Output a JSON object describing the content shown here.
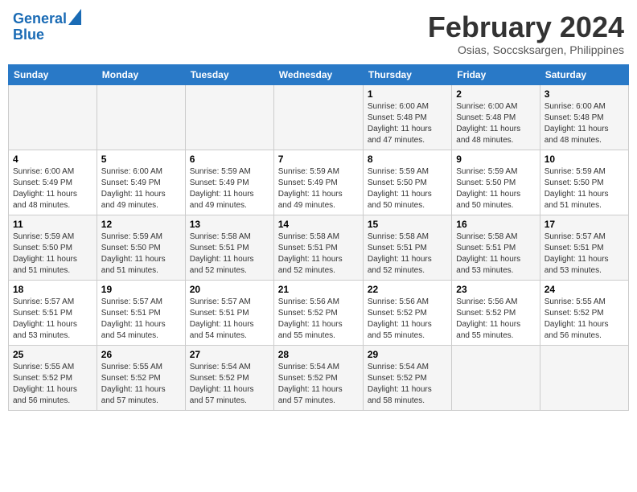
{
  "header": {
    "logo_line1": "General",
    "logo_line2": "Blue",
    "title": "February 2024",
    "subtitle": "Osias, Soccsksargen, Philippines"
  },
  "weekdays": [
    "Sunday",
    "Monday",
    "Tuesday",
    "Wednesday",
    "Thursday",
    "Friday",
    "Saturday"
  ],
  "weeks": [
    [
      {
        "day": "",
        "info": ""
      },
      {
        "day": "",
        "info": ""
      },
      {
        "day": "",
        "info": ""
      },
      {
        "day": "",
        "info": ""
      },
      {
        "day": "1",
        "info": "Sunrise: 6:00 AM\nSunset: 5:48 PM\nDaylight: 11 hours\nand 47 minutes."
      },
      {
        "day": "2",
        "info": "Sunrise: 6:00 AM\nSunset: 5:48 PM\nDaylight: 11 hours\nand 48 minutes."
      },
      {
        "day": "3",
        "info": "Sunrise: 6:00 AM\nSunset: 5:48 PM\nDaylight: 11 hours\nand 48 minutes."
      }
    ],
    [
      {
        "day": "4",
        "info": "Sunrise: 6:00 AM\nSunset: 5:49 PM\nDaylight: 11 hours\nand 48 minutes."
      },
      {
        "day": "5",
        "info": "Sunrise: 6:00 AM\nSunset: 5:49 PM\nDaylight: 11 hours\nand 49 minutes."
      },
      {
        "day": "6",
        "info": "Sunrise: 5:59 AM\nSunset: 5:49 PM\nDaylight: 11 hours\nand 49 minutes."
      },
      {
        "day": "7",
        "info": "Sunrise: 5:59 AM\nSunset: 5:49 PM\nDaylight: 11 hours\nand 49 minutes."
      },
      {
        "day": "8",
        "info": "Sunrise: 5:59 AM\nSunset: 5:50 PM\nDaylight: 11 hours\nand 50 minutes."
      },
      {
        "day": "9",
        "info": "Sunrise: 5:59 AM\nSunset: 5:50 PM\nDaylight: 11 hours\nand 50 minutes."
      },
      {
        "day": "10",
        "info": "Sunrise: 5:59 AM\nSunset: 5:50 PM\nDaylight: 11 hours\nand 51 minutes."
      }
    ],
    [
      {
        "day": "11",
        "info": "Sunrise: 5:59 AM\nSunset: 5:50 PM\nDaylight: 11 hours\nand 51 minutes."
      },
      {
        "day": "12",
        "info": "Sunrise: 5:59 AM\nSunset: 5:50 PM\nDaylight: 11 hours\nand 51 minutes."
      },
      {
        "day": "13",
        "info": "Sunrise: 5:58 AM\nSunset: 5:51 PM\nDaylight: 11 hours\nand 52 minutes."
      },
      {
        "day": "14",
        "info": "Sunrise: 5:58 AM\nSunset: 5:51 PM\nDaylight: 11 hours\nand 52 minutes."
      },
      {
        "day": "15",
        "info": "Sunrise: 5:58 AM\nSunset: 5:51 PM\nDaylight: 11 hours\nand 52 minutes."
      },
      {
        "day": "16",
        "info": "Sunrise: 5:58 AM\nSunset: 5:51 PM\nDaylight: 11 hours\nand 53 minutes."
      },
      {
        "day": "17",
        "info": "Sunrise: 5:57 AM\nSunset: 5:51 PM\nDaylight: 11 hours\nand 53 minutes."
      }
    ],
    [
      {
        "day": "18",
        "info": "Sunrise: 5:57 AM\nSunset: 5:51 PM\nDaylight: 11 hours\nand 53 minutes."
      },
      {
        "day": "19",
        "info": "Sunrise: 5:57 AM\nSunset: 5:51 PM\nDaylight: 11 hours\nand 54 minutes."
      },
      {
        "day": "20",
        "info": "Sunrise: 5:57 AM\nSunset: 5:51 PM\nDaylight: 11 hours\nand 54 minutes."
      },
      {
        "day": "21",
        "info": "Sunrise: 5:56 AM\nSunset: 5:52 PM\nDaylight: 11 hours\nand 55 minutes."
      },
      {
        "day": "22",
        "info": "Sunrise: 5:56 AM\nSunset: 5:52 PM\nDaylight: 11 hours\nand 55 minutes."
      },
      {
        "day": "23",
        "info": "Sunrise: 5:56 AM\nSunset: 5:52 PM\nDaylight: 11 hours\nand 55 minutes."
      },
      {
        "day": "24",
        "info": "Sunrise: 5:55 AM\nSunset: 5:52 PM\nDaylight: 11 hours\nand 56 minutes."
      }
    ],
    [
      {
        "day": "25",
        "info": "Sunrise: 5:55 AM\nSunset: 5:52 PM\nDaylight: 11 hours\nand 56 minutes."
      },
      {
        "day": "26",
        "info": "Sunrise: 5:55 AM\nSunset: 5:52 PM\nDaylight: 11 hours\nand 57 minutes."
      },
      {
        "day": "27",
        "info": "Sunrise: 5:54 AM\nSunset: 5:52 PM\nDaylight: 11 hours\nand 57 minutes."
      },
      {
        "day": "28",
        "info": "Sunrise: 5:54 AM\nSunset: 5:52 PM\nDaylight: 11 hours\nand 57 minutes."
      },
      {
        "day": "29",
        "info": "Sunrise: 5:54 AM\nSunset: 5:52 PM\nDaylight: 11 hours\nand 58 minutes."
      },
      {
        "day": "",
        "info": ""
      },
      {
        "day": "",
        "info": ""
      }
    ]
  ]
}
